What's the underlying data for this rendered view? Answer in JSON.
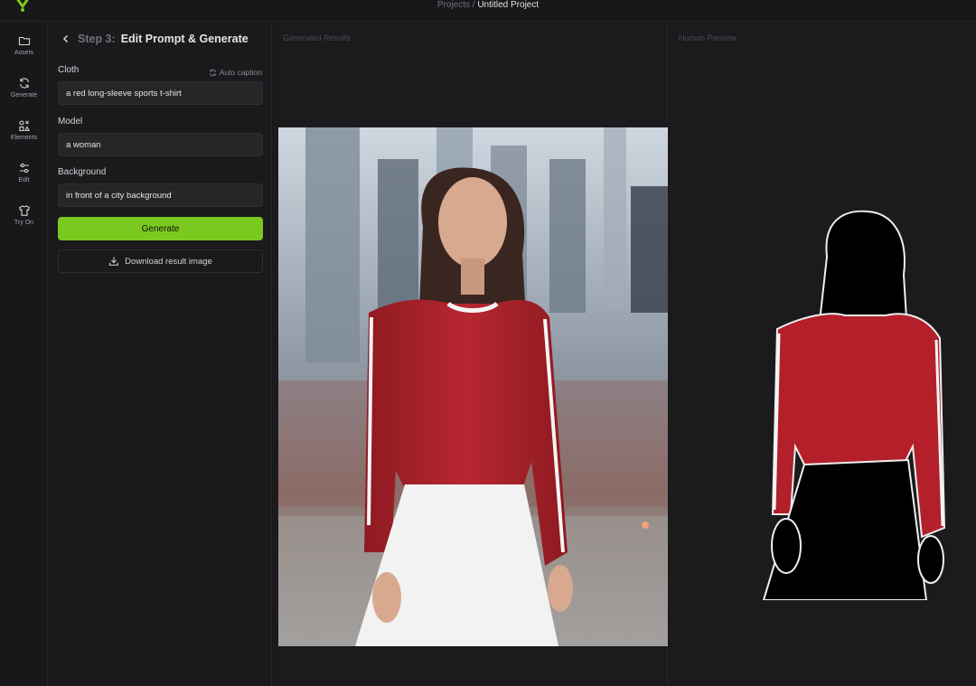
{
  "breadcrumb": {
    "root": "Projects",
    "separator": " / ",
    "current": "Untitled Project"
  },
  "sidebar": {
    "items": [
      {
        "label": "Assets",
        "icon": "folder-icon"
      },
      {
        "label": "Generate",
        "icon": "refresh-icon"
      },
      {
        "label": "Elements",
        "icon": "elements-icon"
      },
      {
        "label": "Edit",
        "icon": "sliders-icon"
      },
      {
        "label": "Try On",
        "icon": "shirt-icon"
      }
    ]
  },
  "panel": {
    "step_number": "Step 3:",
    "step_title": "Edit Prompt & Generate",
    "auto_caption": "Auto caption",
    "fields": {
      "cloth": {
        "label": "Cloth",
        "value": "a red long-sleeve sports t-shirt"
      },
      "model": {
        "label": "Model",
        "value": "a woman"
      },
      "background": {
        "label": "Background",
        "value": "in front of a city background"
      }
    },
    "generate_label": "Generate",
    "download_label": "Download result image"
  },
  "results": {
    "title": "Generated Results"
  },
  "preview": {
    "title": "Human Preview"
  },
  "colors": {
    "accent": "#7ac91f",
    "background": "#18181b",
    "shirt": "#b3202a"
  }
}
